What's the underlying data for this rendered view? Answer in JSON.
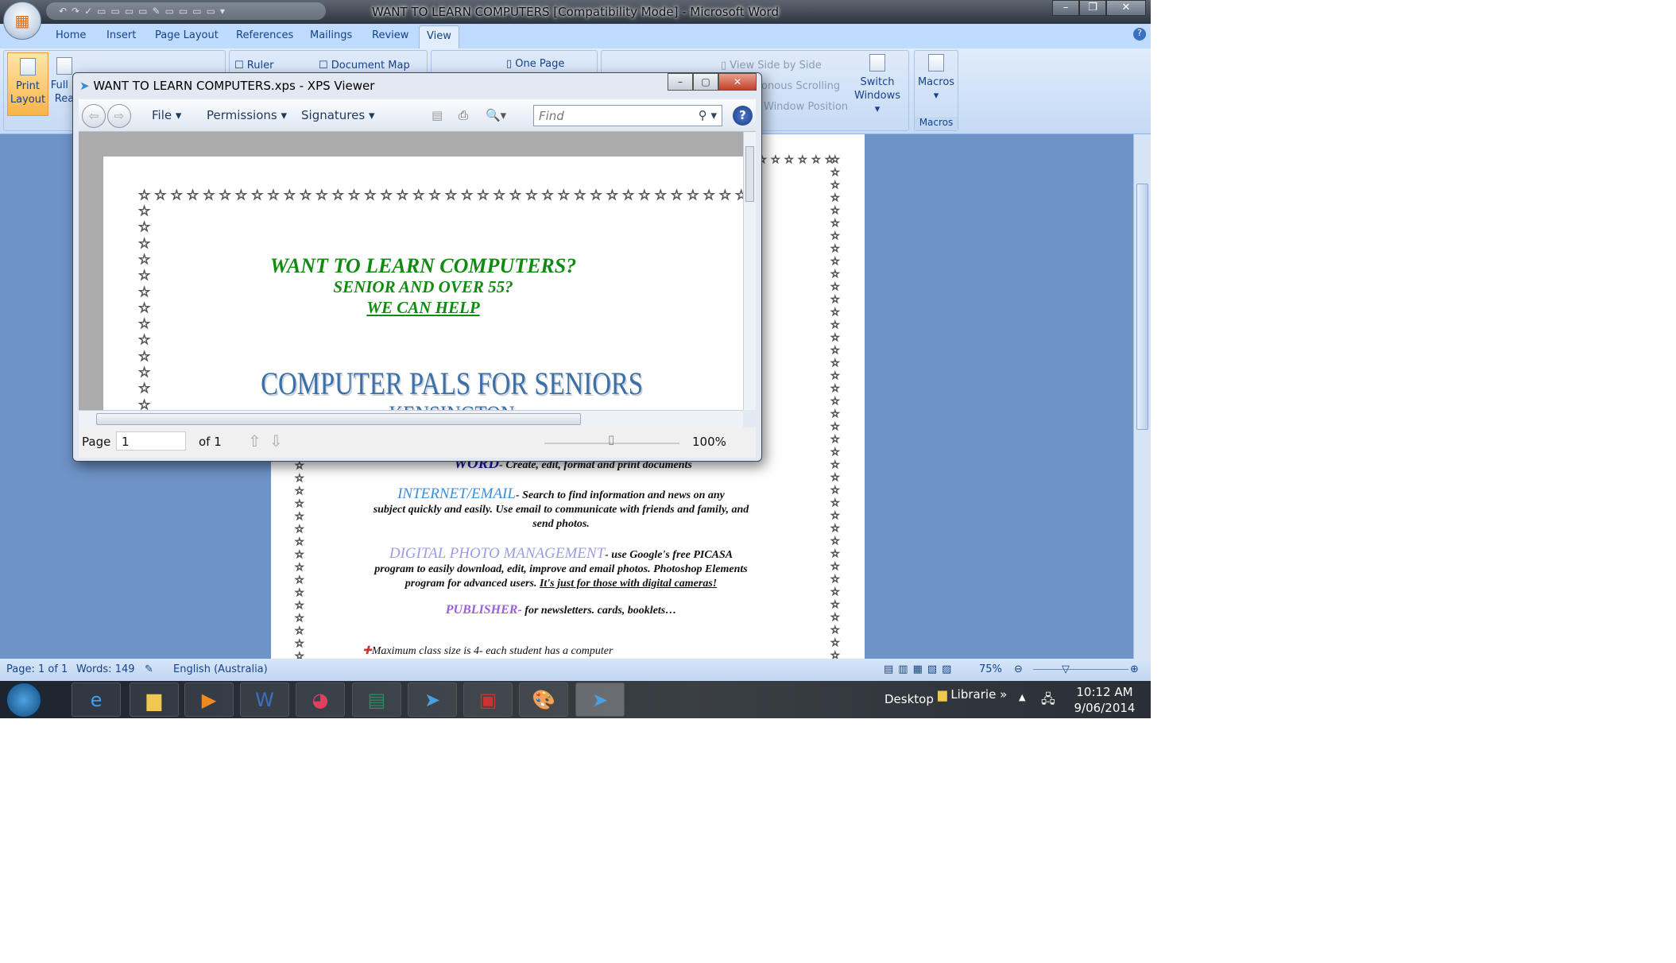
{
  "word": {
    "title": "WANT TO LEARN COMPUTERS [Compatibility Mode] - Microsoft Word",
    "tabs": [
      "Home",
      "Insert",
      "Page Layout",
      "References",
      "Mailings",
      "Review",
      "View"
    ],
    "active_tab": "View",
    "ribbon": {
      "print_layout": "Print Layout",
      "full_screen": "Full S Rea",
      "ruler": "Ruler",
      "document_map": "Document Map",
      "one_page": "One Page",
      "view_side_by_side": "View Side by Side",
      "sync_scrolling": "ronous Scrolling",
      "reset_window": "Window Position",
      "switch_windows": "Switch Windows",
      "macros": "Macros",
      "macros_group": "Macros"
    },
    "document": {
      "star_glyph": "☆",
      "word_line": {
        "label": "WORD",
        "text": "- Create, edit, format and print documents"
      },
      "internet": {
        "label": "INTERNET/EMAIL",
        "text": "- Search to find information and news on any",
        "line2": "subject quickly and easily. Use email to communicate with friends and family, and",
        "line3": "send photos."
      },
      "photo": {
        "label": "DIGITAL PHOTO MANAGEMENT",
        "text": "- use Google's free PICASA",
        "line2": "program to easily download, edit, improve and email photos. Photoshop Elements",
        "line3a": "program for advanced users. ",
        "line3b": "It's just for those with digital cameras!"
      },
      "publisher": {
        "label": "PUBLISHER-",
        "text": " for newsletters. cards, booklets…"
      },
      "bullet": "Maximum class size is 4- each student has a computer",
      "colors": {
        "word": "#1a1a9a",
        "internet": "#3a8fe0",
        "photo": "#9b9be8",
        "publisher": "#9a5ee0"
      }
    },
    "status": {
      "page": "Page: 1 of 1",
      "words": "Words: 149",
      "language": "English (Australia)",
      "zoom": "75%"
    }
  },
  "xps": {
    "title": "WANT TO LEARN COMPUTERS.xps - XPS Viewer",
    "menus": [
      "File",
      "Permissions",
      "Signatures"
    ],
    "find_placeholder": "Find",
    "content": {
      "h1": "WANT TO LEARN COMPUTERS?",
      "h2": "SENIOR AND OVER 55?",
      "h3": "WE CAN HELP",
      "pals": "COMPUTER PALS FOR SENIORS",
      "place": "KENSINGTON",
      "heading_color": "#118a11"
    },
    "page_label": "Page",
    "page_value": "1",
    "page_of": "of 1",
    "zoom": "100%",
    "zoom_level": 0.5
  },
  "taskbar": {
    "desktop": "Desktop",
    "libraries": "Librarie",
    "more": "»",
    "time": "10:12 AM",
    "date": "9/06/2014",
    "apps": [
      "internet-explorer",
      "file-explorer",
      "media-player",
      "word",
      "picasa",
      "publisher",
      "xps-viewer",
      "acrobat",
      "paint",
      "xps-viewer-active"
    ]
  }
}
